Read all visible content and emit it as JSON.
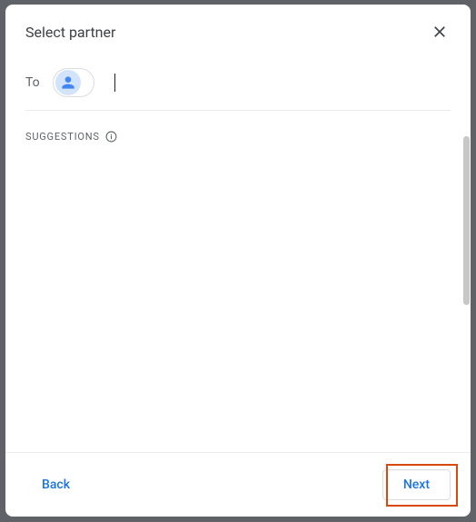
{
  "header": {
    "title": "Select partner"
  },
  "to": {
    "label": "To"
  },
  "suggestions": {
    "label": "SUGGESTIONS"
  },
  "footer": {
    "back_label": "Back",
    "next_label": "Next"
  }
}
